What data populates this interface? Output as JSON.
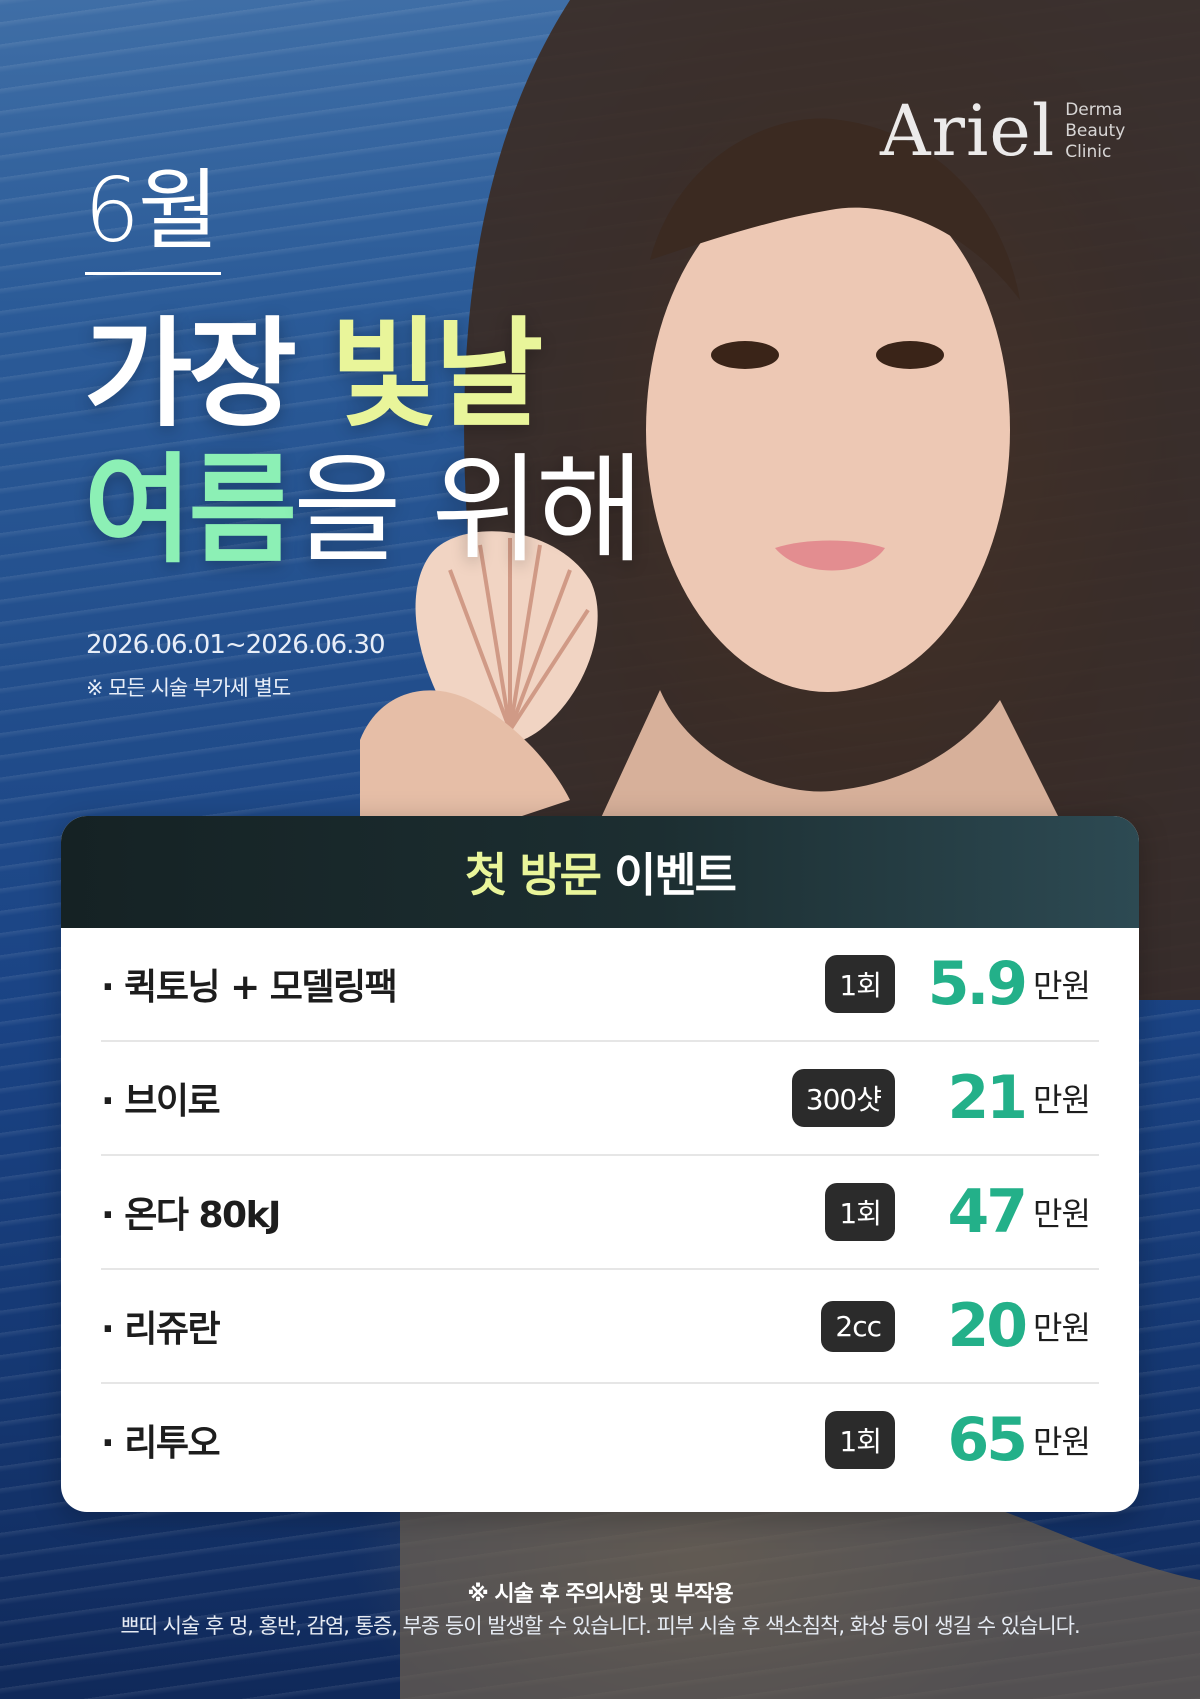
{
  "brand": {
    "logo": "Ariel",
    "logo_sub": [
      "Derma",
      "Beauty",
      "Clinic"
    ]
  },
  "header": {
    "month": "6월",
    "headline": {
      "line1_a": "가장 ",
      "line1_b": "빛날",
      "line2_a": "여름",
      "line2_b": "을 위해"
    },
    "period": "2026.06.01~2026.06.30",
    "vat_note": "※ 모든 시술 부가세 별도"
  },
  "event": {
    "title_accent": "첫 방문",
    "title_rest": " 이벤트",
    "items": [
      {
        "name": "· 퀵토닝 + 모델링팩",
        "qty": "1회",
        "price": "5.9",
        "unit": "만원"
      },
      {
        "name": "· 브이로",
        "qty": "300샷",
        "price": "21",
        "unit": "만원"
      },
      {
        "name": "· 온다 80kJ",
        "qty": "1회",
        "price": "47",
        "unit": "만원"
      },
      {
        "name": "· 리쥬란",
        "qty": "2cc",
        "price": "20",
        "unit": "만원"
      },
      {
        "name": "· 리투오",
        "qty": "1회",
        "price": "65",
        "unit": "만원"
      }
    ]
  },
  "notice": {
    "title": "※ 시술 후 주의사항 및 부작용",
    "body": "쁘띠 시술 후 멍, 홍반, 감염, 통증, 부종 등이 발생할 수 있습니다. 피부 시술 후 색소침착, 화상 등이 생길 수 있습니다."
  },
  "colors": {
    "accent_yellow": "#e9f59a",
    "accent_mint": "#8cf0b5",
    "price_green": "#23b089",
    "card_header": "#1c2e31"
  },
  "icons": {
    "background_photo": "woman-holding-seashell-by-sea"
  }
}
